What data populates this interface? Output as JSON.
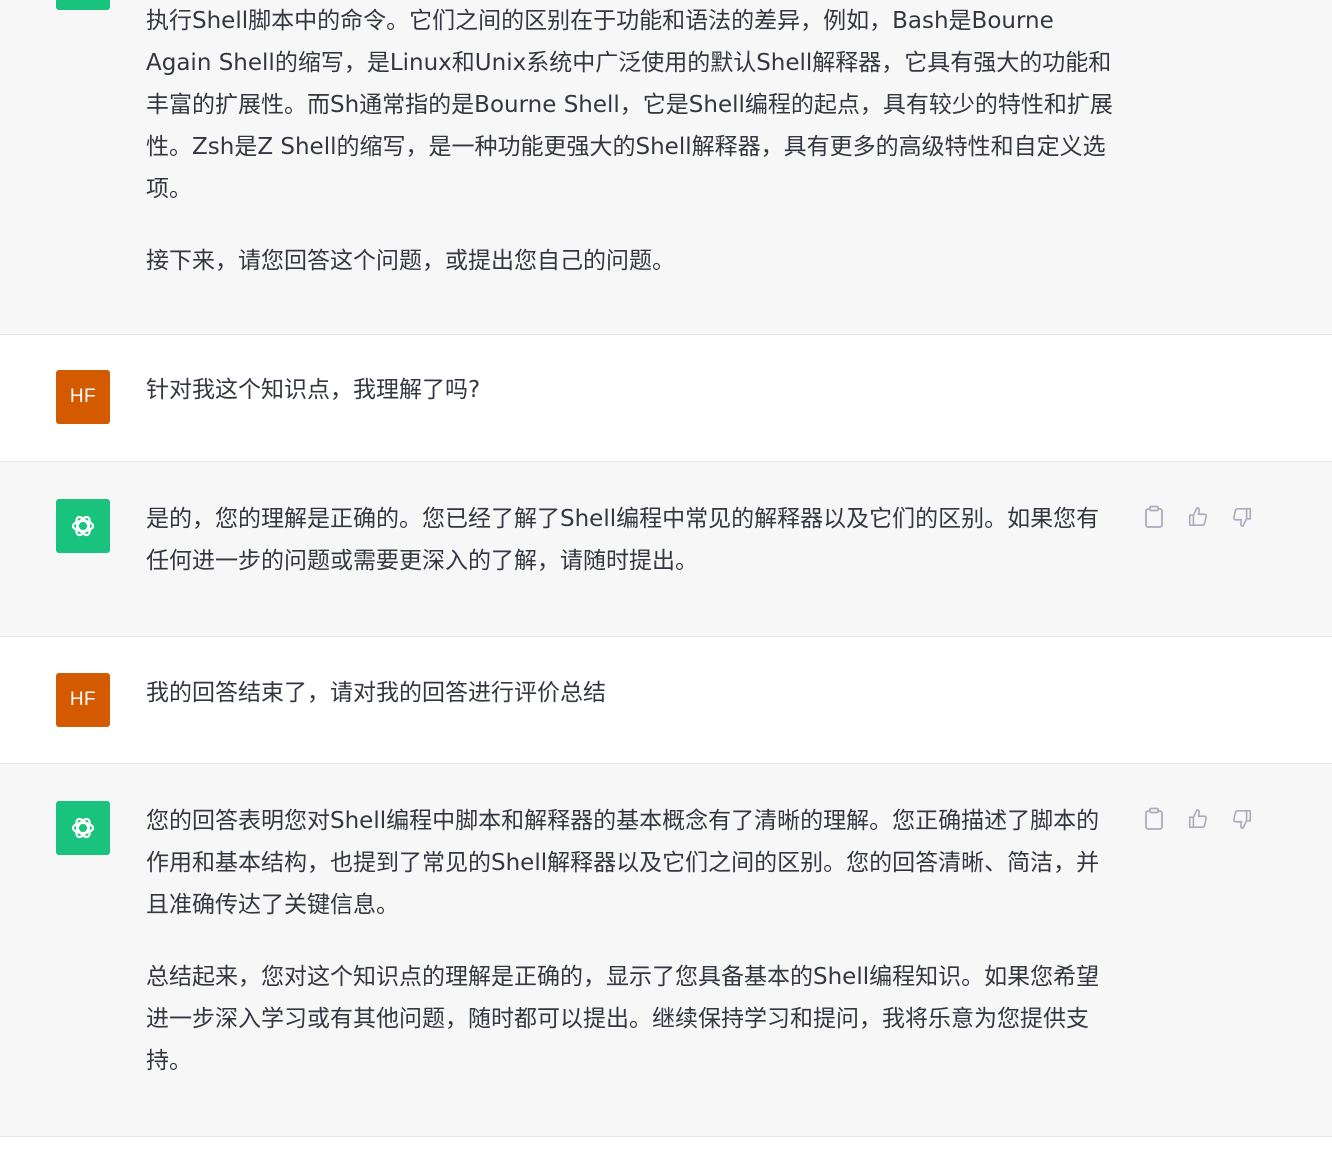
{
  "messages": [
    {
      "role": "assistant",
      "paragraphs": [
        "执行Shell脚本中的命令。它们之间的区别在于功能和语法的差异，例如，Bash是Bourne Again Shell的缩写，是Linux和Unix系统中广泛使用的默认Shell解释器，它具有强大的功能和丰富的扩展性。而Sh通常指的是Bourne Shell，它是Shell编程的起点，具有较少的特性和扩展性。Zsh是Z Shell的缩写，是一种功能更强大的Shell解释器，具有更多的高级特性和自定义选项。",
        "接下来，请您回答这个问题，或提出您自己的问题。"
      ]
    },
    {
      "role": "user",
      "avatar": "HF",
      "paragraphs": [
        "针对我这个知识点，我理解了吗?"
      ]
    },
    {
      "role": "assistant",
      "paragraphs": [
        "是的，您的理解是正确的。您已经了解了Shell编程中常见的解释器以及它们的区别。如果您有任何进一步的问题或需要更深入的了解，请随时提出。"
      ]
    },
    {
      "role": "user",
      "avatar": "HF",
      "paragraphs": [
        "我的回答结束了，请对我的回答进行评价总结"
      ]
    },
    {
      "role": "assistant",
      "paragraphs": [
        "您的回答表明您对Shell编程中脚本和解释器的基本概念有了清晰的理解。您正确描述了脚本的作用和基本结构，也提到了常见的Shell解释器以及它们之间的区别。您的回答清晰、简洁，并且准确传达了关键信息。",
        "总结起来，您对这个知识点的理解是正确的，显示了您具备基本的Shell编程知识。如果您希望进一步深入学习或有其他问题，随时都可以提出。继续保持学习和提问，我将乐意为您提供支持。"
      ]
    }
  ],
  "icons": {
    "assistant_avatar": "openai-logo-icon",
    "copy": "clipboard-icon",
    "like": "thumbs-up-icon",
    "dislike": "thumbs-down-icon"
  },
  "colors": {
    "assistant_bg": "#f7f7f8",
    "user_bg": "#ffffff",
    "user_avatar_bg": "#d45a00",
    "assistant_avatar_bg": "#19c37d",
    "text": "#353740",
    "icon": "#acacbe",
    "divider": "#e5e5e6"
  }
}
